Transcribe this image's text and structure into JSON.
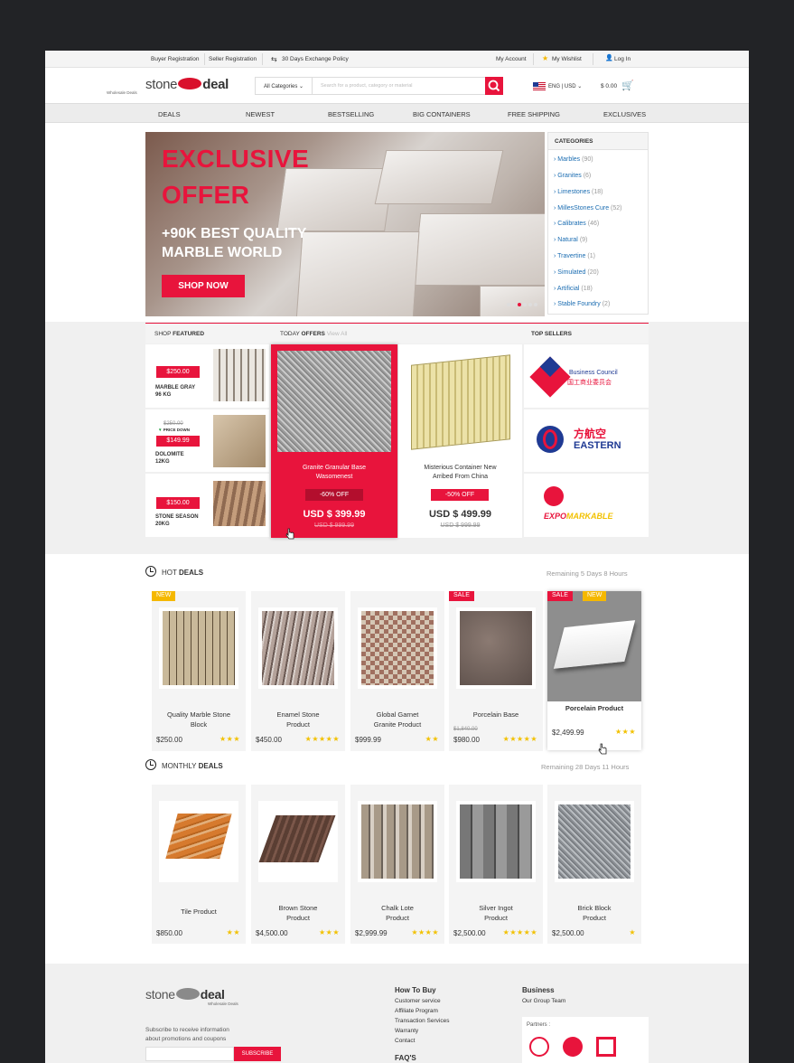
{
  "topbar": {
    "buyer": "Buyer Registration",
    "seller": "Seller Registration",
    "exchange": "30 Days Exchange Policy",
    "account": "My Account",
    "wishlist": "My Wishlist",
    "login": "Log In"
  },
  "header": {
    "logo_a": "stone",
    "logo_b": "deal",
    "logo_sub": "Wholesale Deals",
    "category_select": "All Categories",
    "search_placeholder": "Search for a product, category or material",
    "locale": "ENG | USD",
    "cart_total": "$ 0.00"
  },
  "nav": [
    "DEALS",
    "NEWEST",
    "BESTSELLING",
    "BIG CONTAINERS",
    "FREE SHIPPING",
    "EXCLUSIVES"
  ],
  "hero": {
    "title_1": "EXCLUSIVE",
    "title_2": "OFFER",
    "sub_1": "+90K BEST QUALITY",
    "sub_2": "MARBLE WORLD",
    "cta": "SHOP NOW"
  },
  "categories": {
    "title": "CATEGORIES",
    "items": [
      {
        "name": "Marbles",
        "count": "(90)"
      },
      {
        "name": "Granites",
        "count": "(6)"
      },
      {
        "name": "Limestones",
        "count": "(18)"
      },
      {
        "name": "MillesStones Cure",
        "count": "(52)"
      },
      {
        "name": "Calibrates",
        "count": "(46)"
      },
      {
        "name": "Natural",
        "count": "(9)"
      },
      {
        "name": "Travertine",
        "count": "(1)"
      },
      {
        "name": "Simulated",
        "count": "(20)"
      },
      {
        "name": "Artificial",
        "count": "(18)"
      },
      {
        "name": "Stable Foundry",
        "count": "(2)"
      }
    ]
  },
  "featured": {
    "shop_label": "SHOP",
    "shop_bold": "FEATURED",
    "today_label": "TODAY",
    "today_bold": "OFFERS",
    "view_all": "View All",
    "top_sellers": "TOP SELLERS",
    "items": [
      {
        "price": "$250.00",
        "name_1": "MARBLE GRAY",
        "name_2": "96 KG"
      },
      {
        "old": "$250.00",
        "drop": "PRICE DOWN",
        "price": "$149.99",
        "name_1": "DOLOMITE",
        "name_2": "12KG"
      },
      {
        "price": "$150.00",
        "name_1": "STONE SEASON",
        "name_2": "20KG"
      }
    ],
    "offers": [
      {
        "name_1": "Granite Granular Base",
        "name_2": "Wasomenest",
        "off": "-60% OFF",
        "price": "USD $ 399.99",
        "old": "USD $ 999.99"
      },
      {
        "name_1": "Misterious Container New",
        "name_2": "Arribed From China",
        "off": "-50% OFF",
        "price": "USD $ 499.99",
        "old": "USD $ 999.99"
      }
    ],
    "sellers": [
      {
        "line_1": "Business Council",
        "line_2": "国工商业委员会"
      },
      {
        "line_1": "方航空",
        "line_2": "EASTERN"
      },
      {
        "line_1": "EXPO",
        "line_2": "MARKABLE"
      }
    ]
  },
  "hot_deals": {
    "label": "HOT",
    "bold": "DEALS",
    "remaining": "Remaining 5 Days  8 Hours",
    "products": [
      {
        "name_1": "Quality Marble Stone",
        "name_2": "Block",
        "price": "$250.00",
        "stars": "★★★",
        "badge": "NEW"
      },
      {
        "name_1": "Enamel Stone",
        "name_2": "Product",
        "price": "$450.00",
        "stars": "★★★★★"
      },
      {
        "name_1": "Global Garnet",
        "name_2": "Granite Product",
        "price": "$999.99",
        "stars": "★★"
      },
      {
        "name_1": "Porcelain Base",
        "name_2": "",
        "old": "$1,840.00",
        "price": "$980.00",
        "stars": "★★★★★",
        "badge": "SALE"
      },
      {
        "name_1": "Porcelain Product",
        "name_2": "",
        "price": "$2,499.99",
        "stars": "★★★",
        "badge": "SALE",
        "badge2": "NEW"
      }
    ]
  },
  "monthly_deals": {
    "label": "MONTHLY",
    "bold": "DEALS",
    "remaining": "Remaining 28 Days  11 Hours",
    "products": [
      {
        "name_1": "Tile Product",
        "name_2": "",
        "price": "$850.00",
        "stars": "★★"
      },
      {
        "name_1": "Brown Stone",
        "name_2": "Product",
        "price": "$4,500.00",
        "stars": "★★★"
      },
      {
        "name_1": "Chalk Lote",
        "name_2": "Product",
        "price": "$2,999.99",
        "stars": "★★★★"
      },
      {
        "name_1": "Silver Ingot",
        "name_2": "Product",
        "price": "$2,500.00",
        "stars": "★★★★★"
      },
      {
        "name_1": "Brick Block",
        "name_2": "Product",
        "price": "$2,500.00",
        "stars": "★"
      }
    ]
  },
  "footer": {
    "subscribe_1": "Subscribe to receive information",
    "subscribe_2": "about promotions and coupons",
    "subscribe_btn": "SUBSCRIBE",
    "how_to_buy": "How To Buy",
    "links": [
      "Customer service",
      "Affiliate Program",
      "Transaction Services",
      "Warranty",
      "Contact"
    ],
    "faqs": "FAQ'S",
    "business": "Business",
    "business_link": "Our Group Team",
    "partners": "Partners :"
  },
  "colors": {
    "accent": "#e8143c",
    "star": "#f2c100",
    "new_badge": "#f5b800",
    "link": "#1b6db2"
  }
}
